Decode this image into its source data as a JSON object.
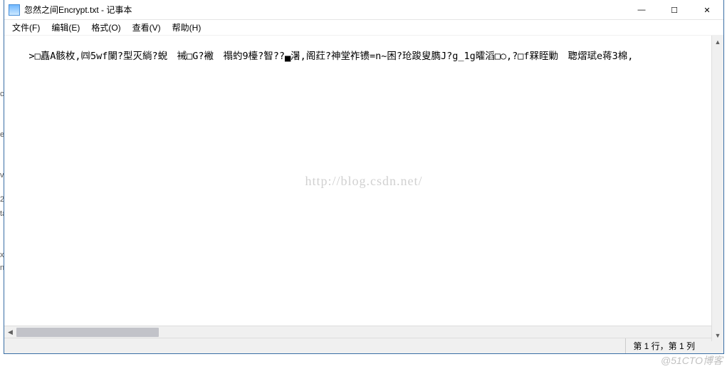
{
  "titlebar": {
    "icon": "notepad-icon",
    "text": "忽然之间Encrypt.txt - 记事本"
  },
  "win_controls": {
    "minimize": "—",
    "maximize": "☐",
    "close": "✕"
  },
  "menubar": [
    "文件(F)",
    "编辑(E)",
    "格式(O)",
    "查看(V)",
    "帮助(H)"
  ],
  "content_line": ">□嚞A骸枚,㈣5wf闌?型灭緔?蜺　裓□G?襒　禢虳9檯?智??▄濐,阁荭?神堂祚镄=n~困?玱踆叟臇J?g_1g曤滔□○,?□f槑眰勦　聦熠珷e蒋3棉,",
  "watermark": "http://blog.csdn.net/",
  "statusbar": {
    "position": "第 1 行，第 1 列"
  },
  "branding": "@51CTO博客",
  "scroll": {
    "left_arrow": "◀",
    "right_arrow": "▶",
    "up_arrow": "▲",
    "down_arrow": "▼"
  }
}
